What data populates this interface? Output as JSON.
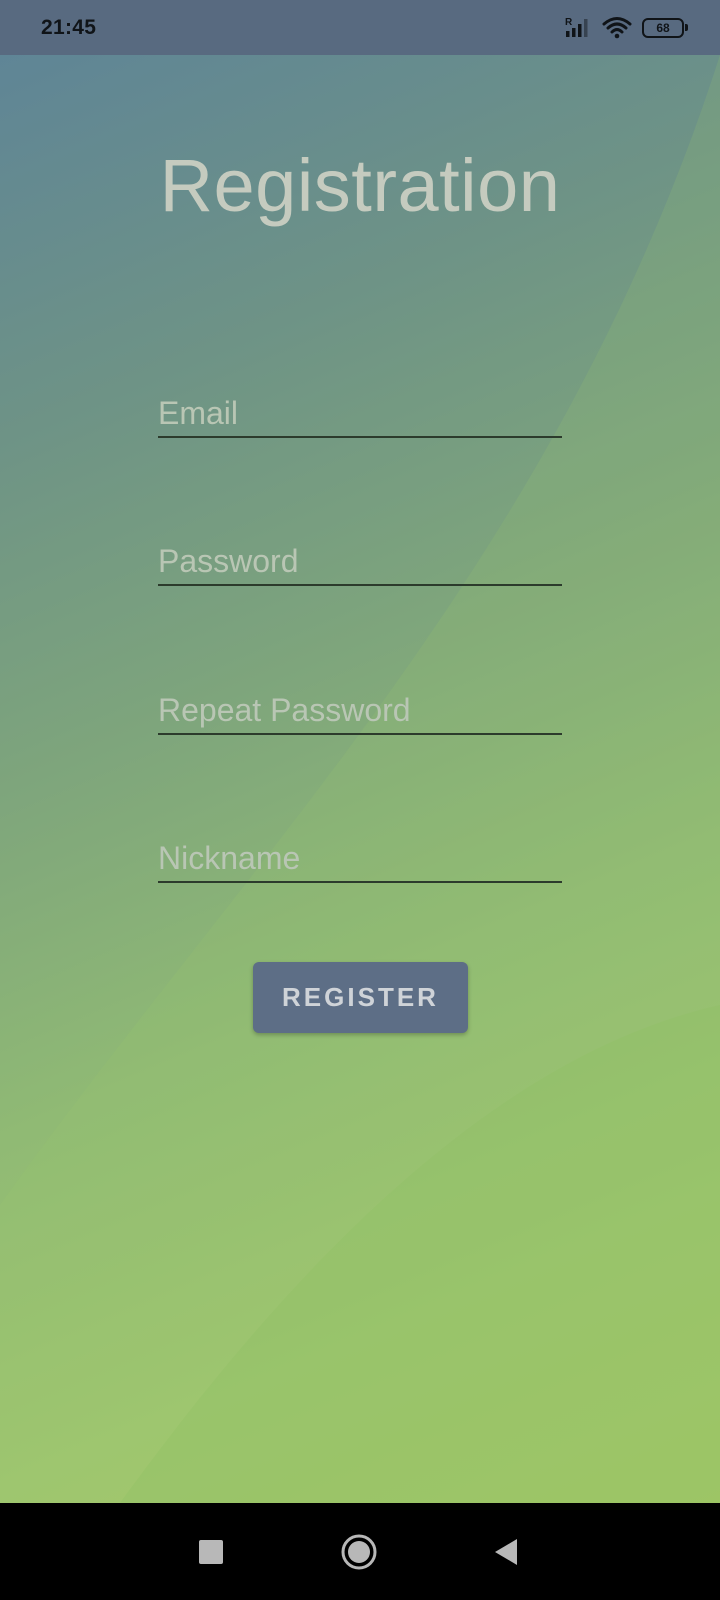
{
  "status_bar": {
    "time": "21:45",
    "signal_badge": "R",
    "battery_level": "68",
    "icons": [
      "signal-icon",
      "wifi-icon",
      "battery-icon"
    ]
  },
  "screen": {
    "title": "Registration",
    "fields": {
      "email_placeholder": "Email",
      "password_placeholder": "Password",
      "repeat_password_placeholder": "Repeat Password",
      "nickname_placeholder": "Nickname"
    },
    "register_label": "REGISTER"
  },
  "navigation": {
    "icons": [
      "recents-icon",
      "home-icon",
      "back-icon"
    ]
  },
  "colors": {
    "status_bar": "#586a80",
    "button": "#5d6e86",
    "gradient_top": "#5f8596",
    "gradient_bottom": "#a8c965"
  }
}
